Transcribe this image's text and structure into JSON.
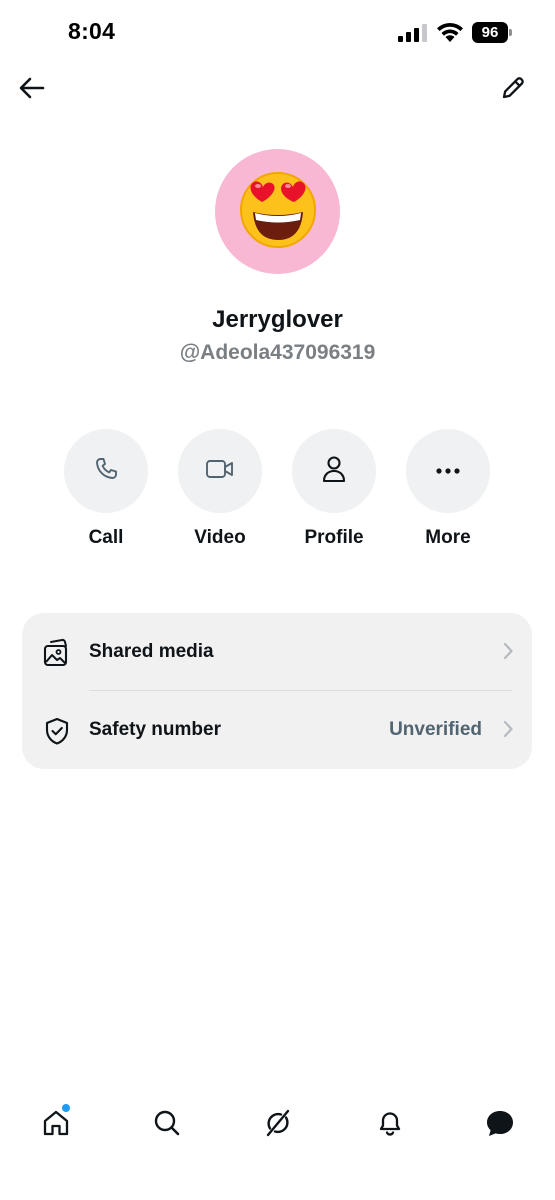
{
  "status_bar": {
    "time": "8:04",
    "battery": "96",
    "icons": [
      "signal-icon",
      "wifi-icon",
      "battery-icon"
    ]
  },
  "header": {
    "back_icon": "arrow-left-icon",
    "edit_icon": "pencil-icon"
  },
  "profile": {
    "avatar_icon": "heart-eyes-emoji",
    "avatar_bg": "#f8b8d3",
    "display_name": "Jerryglover",
    "handle": "@Adeola437096319"
  },
  "actions": [
    {
      "label": "Call",
      "icon": "phone-icon"
    },
    {
      "label": "Video",
      "icon": "video-camera-icon"
    },
    {
      "label": "Profile",
      "icon": "person-icon"
    },
    {
      "label": "More",
      "icon": "more-dots-icon"
    }
  ],
  "settings": {
    "shared_media": {
      "label": "Shared media",
      "icon": "media-gallery-icon"
    },
    "safety_number": {
      "label": "Safety number",
      "value": "Unverified",
      "icon": "shield-check-icon"
    }
  },
  "bottom_nav": {
    "items": [
      "home-icon",
      "search-icon",
      "grok-icon",
      "bell-icon",
      "messages-icon"
    ],
    "accent": "#1d9bf0"
  }
}
